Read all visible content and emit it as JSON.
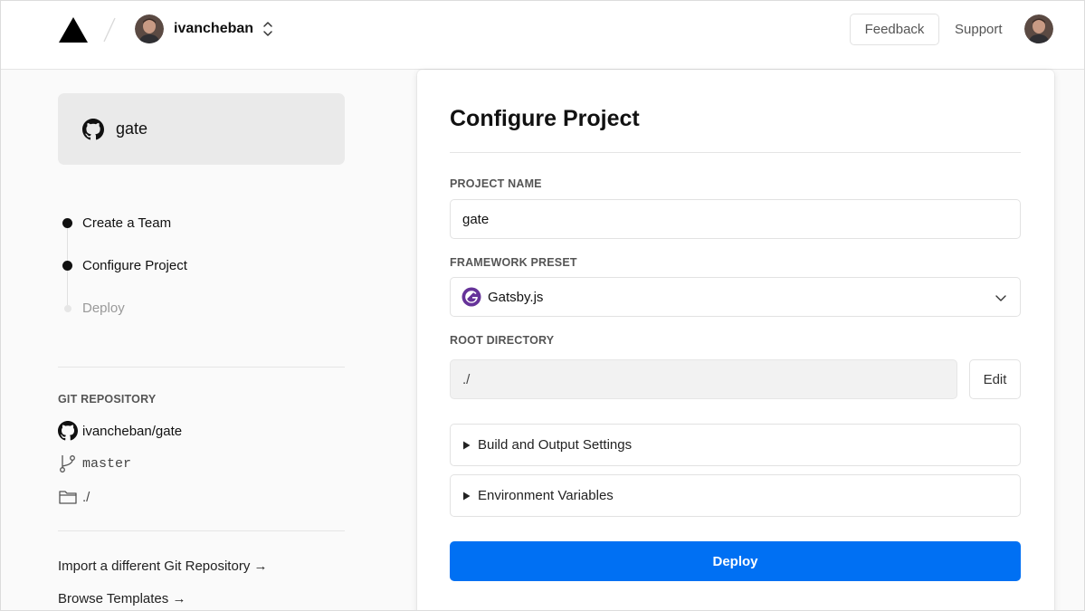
{
  "header": {
    "team_name": "ivancheban",
    "feedback_label": "Feedback",
    "support_label": "Support"
  },
  "sidebar": {
    "repo_card_name": "gate",
    "steps": [
      {
        "label": "Create a Team",
        "state": "done"
      },
      {
        "label": "Configure Project",
        "state": "current"
      },
      {
        "label": "Deploy",
        "state": "pending"
      }
    ],
    "git_title": "GIT REPOSITORY",
    "git_repo": "ivancheban/gate",
    "git_branch": "master",
    "git_path": "./",
    "links": [
      {
        "label": "Import a different Git Repository →"
      },
      {
        "label": "Browse Templates →"
      }
    ]
  },
  "main": {
    "title": "Configure Project",
    "project_name_label": "PROJECT NAME",
    "project_name_value": "gate",
    "framework_label": "FRAMEWORK PRESET",
    "framework_value": "Gatsby.js",
    "root_label": "ROOT DIRECTORY",
    "root_value": "./",
    "edit_label": "Edit",
    "build_settings_label": "Build and Output Settings",
    "env_vars_label": "Environment Variables",
    "deploy_label": "Deploy"
  },
  "colors": {
    "accent": "#0070f3",
    "gatsby": "#663399",
    "text": "#111111",
    "muted": "#999999"
  },
  "icons": {
    "logo": "vercel-triangle-icon",
    "team_switch": "chevron-up-down-icon",
    "repo": "github-icon",
    "branch": "git-branch-icon",
    "folder": "folder-icon",
    "framework": "gatsby-icon",
    "select": "chevron-down-icon",
    "accordion": "triangle-right-icon"
  }
}
